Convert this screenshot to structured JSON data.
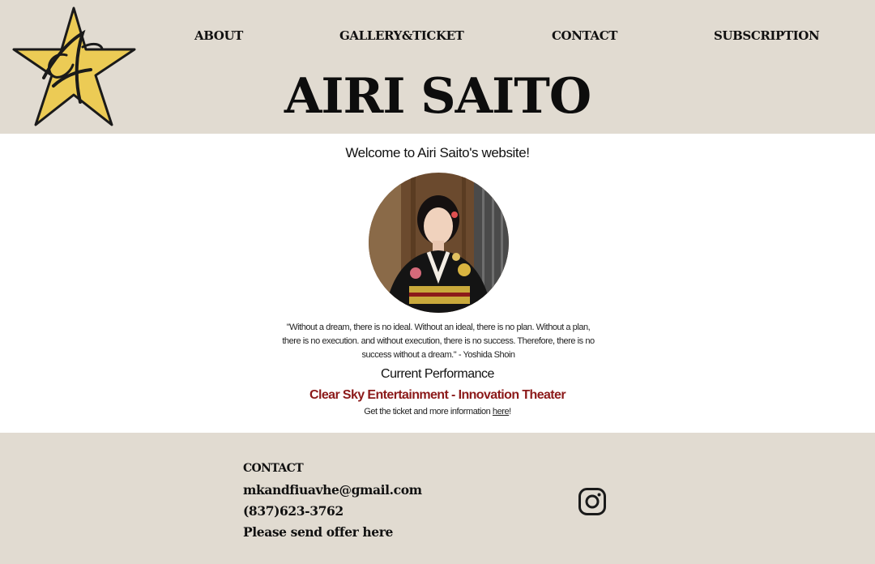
{
  "header": {
    "logo_icon": "star-signature-logo",
    "nav": {
      "about": "ABOUT",
      "gallery": "GALLERY&TICKET",
      "contact": "CONTACT",
      "subscription": "SUBSCRIPTION"
    },
    "site_title": "AIRI SAITO"
  },
  "main": {
    "welcome": "Welcome to Airi Saito's website!",
    "quote_lines": [
      "\"Without a dream, there is no ideal. Without an ideal, there is no plan. Without a plan,",
      "there is no execution. and without execution, there is no success. Therefore, there is no",
      "success without a dream.\" - Yoshida Shoin"
    ],
    "current_performance_heading": "Current Performance",
    "performance_title": "Clear Sky Entertainment - Innovation Theater",
    "ticket_prefix": "Get the ticket and more information ",
    "ticket_link": "here",
    "ticket_suffix": "!"
  },
  "footer": {
    "contact_heading": "CONTACT",
    "email": "mkandfiuavhe@gmail.com",
    "phone": "(837)623-3762",
    "offer_link": "Please send offer here",
    "social_icon": "instagram-icon"
  },
  "colors": {
    "header_bg": "#e1dbd1",
    "footer_bg": "#e1dbd1",
    "performance_title": "#8c1a1a",
    "logo_star": "#eccb55"
  }
}
